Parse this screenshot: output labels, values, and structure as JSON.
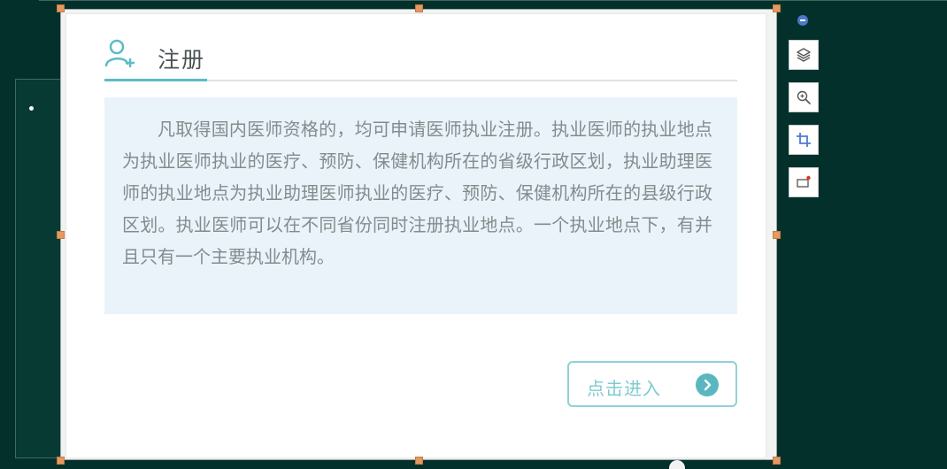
{
  "card": {
    "title": "注册",
    "description": "凡取得国内医师资格的，均可申请医师执业注册。执业医师的执业地点为执业医师执业的医疗、预防、保健机构所在的省级行政区划，执业助理医师的执业地点为执业助理医师执业的医疗、预防、保健机构所在的县级行政区划。执业医师可以在不同省份同时注册执业地点。一个执业地点下，有并且只有一个主要执业机构。",
    "enter_button": "点击进入"
  },
  "toolbar": {
    "items": [
      {
        "icon": "minus-circle-icon"
      },
      {
        "icon": "layers-icon"
      },
      {
        "icon": "zoom-in-icon"
      },
      {
        "icon": "crop-icon"
      },
      {
        "icon": "screen-capture-icon"
      }
    ]
  },
  "colors": {
    "background": "#03302a",
    "accent": "#5bbcc4",
    "handle": "#e39a62",
    "description_bg": "#eaf3fa"
  }
}
